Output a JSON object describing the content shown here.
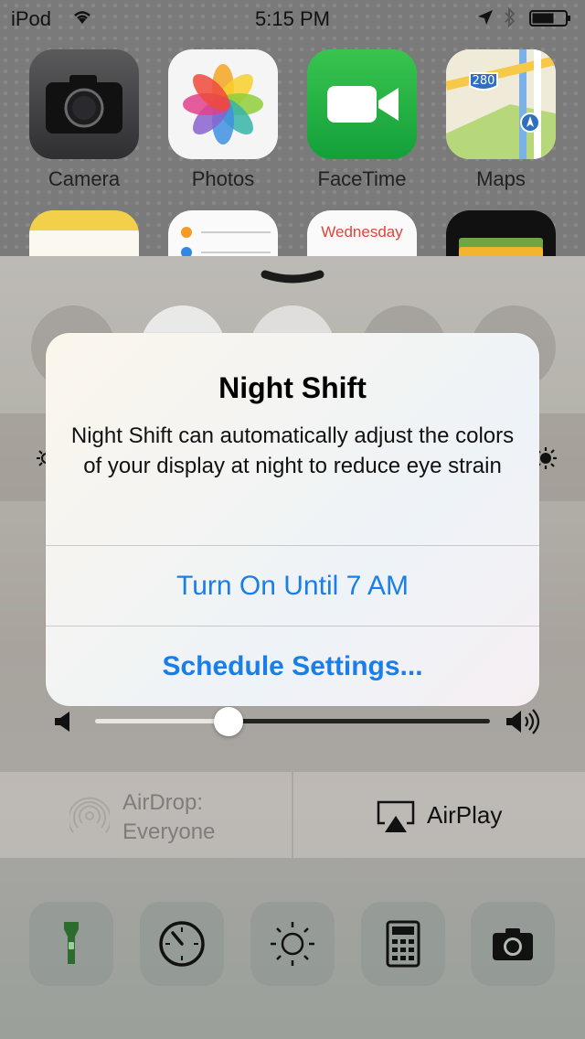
{
  "status_bar": {
    "carrier": "iPod",
    "time": "5:15 PM"
  },
  "home_apps": [
    {
      "label": "Camera"
    },
    {
      "label": "Photos"
    },
    {
      "label": "FaceTime"
    },
    {
      "label": "Maps"
    },
    {
      "label": ""
    },
    {
      "label": ""
    },
    {
      "label": "",
      "tile_text": "Wednesday"
    },
    {
      "label": ""
    }
  ],
  "maps_shield": "280",
  "dialog": {
    "title": "Night Shift",
    "message": "Night Shift can automatically adjust the colors of your display at night to reduce eye strain",
    "primary_button": "Turn On Until 7 AM",
    "secondary_button": "Schedule Settings..."
  },
  "volume": {
    "level": 0.34
  },
  "share_row": {
    "airdrop_line1": "AirDrop:",
    "airdrop_line2": "Everyone",
    "airplay_label": "AirPlay"
  },
  "tools": [
    {
      "icon": "flashlight-icon"
    },
    {
      "icon": "timer-icon"
    },
    {
      "icon": "night-shift-icon"
    },
    {
      "icon": "calculator-icon"
    },
    {
      "icon": "camera-icon"
    }
  ],
  "colors": {
    "accent": "#1a7ee8",
    "flashlight": "#2e6b2e"
  }
}
